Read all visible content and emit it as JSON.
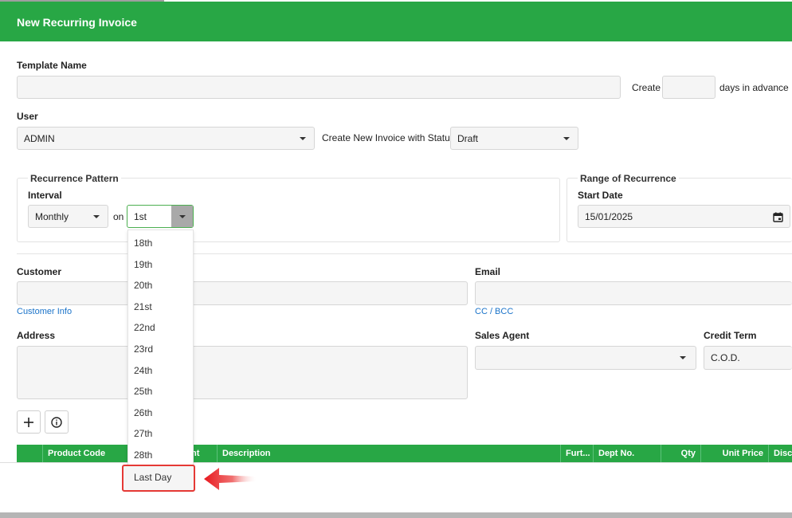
{
  "header": {
    "title": "New Recurring Invoice"
  },
  "template": {
    "name_label": "Template Name",
    "name_value": "",
    "create_label": "Create",
    "create_days_value": "",
    "days_suffix": "days in advance"
  },
  "user": {
    "label": "User",
    "value": "ADMIN",
    "status_label": "Create New Invoice with Status:",
    "status_value": "Draft"
  },
  "recurrence": {
    "legend": "Recurrence Pattern",
    "interval_label": "Interval",
    "interval_value": "Monthly",
    "on_label": "on",
    "day_value": "1st"
  },
  "range": {
    "legend": "Range of Recurrence",
    "start_label": "Start Date",
    "start_value": "15/01/2025"
  },
  "customer": {
    "label": "Customer",
    "value": "",
    "info_link": "Customer Info"
  },
  "email": {
    "label": "Email",
    "value": "",
    "cc_link": "CC / BCC"
  },
  "address": {
    "label": "Address",
    "value": ""
  },
  "sales_agent": {
    "label": "Sales Agent",
    "value": ""
  },
  "credit_term": {
    "label": "Credit Term",
    "value": "C.O.D."
  },
  "toolbar": {
    "add_icon": "plus-icon",
    "info_icon": "info-icon"
  },
  "table": {
    "columns": [
      "",
      "Product Code",
      "nt",
      "Description",
      "Furt...",
      "Dept No.",
      "Qty",
      "Unit Price",
      "Disco"
    ]
  },
  "dropdown": {
    "options": [
      "18th",
      "19th",
      "20th",
      "21st",
      "22nd",
      "23rd",
      "24th",
      "25th",
      "26th",
      "27th",
      "28th",
      "Last Day"
    ],
    "highlighted": "Last Day"
  },
  "colors": {
    "brand": "#28a745",
    "highlight": "#e53935",
    "link": "#1a73c9"
  }
}
